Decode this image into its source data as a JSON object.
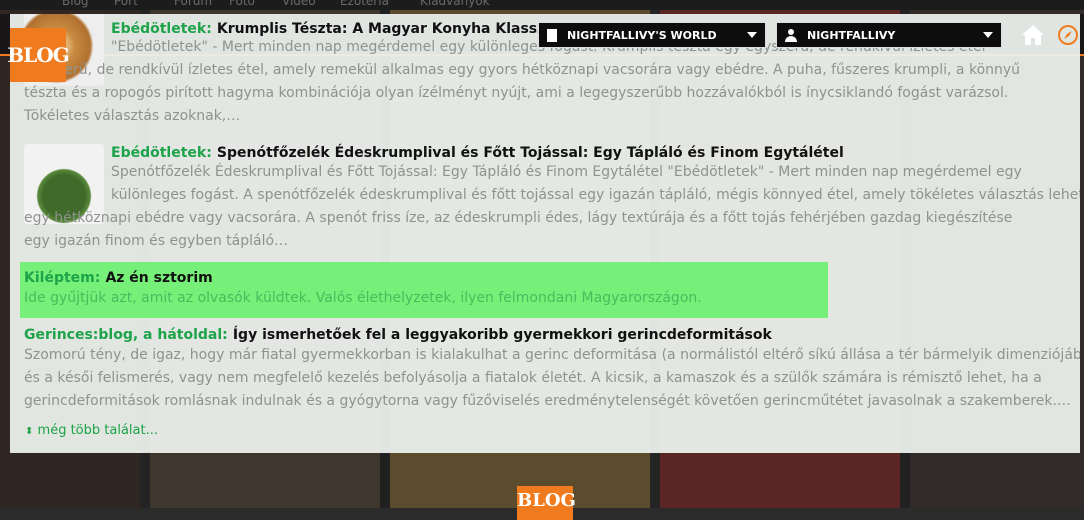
{
  "header": {
    "logo_text": "BLOG",
    "world_dropdown": "NIGHTFALLIVY'S WORLD",
    "user_dropdown": "NIGHTFALLIVY",
    "top_nav": [
      "Blog",
      "Port",
      "Fórum",
      "Fotó",
      "Videó",
      "Ezoteria",
      "Kiadványok"
    ]
  },
  "results": [
    {
      "category": "Ebédötletek:",
      "title": "Krumplis Tészta: A Magyar Konyha Klasszikusa",
      "text_lines": [
        "\"Ebédötletek\" - Mert minden nap megérdemel egy különleges fogást. Krumplis tészta egy egyszerű, de rendkívül ízletes étel",
        "egyszerű, de rendkívül ízletes étel, amely remekül alkalmas egy gyors hétköznapi vacsorára vagy ebédre. A puha, fűszeres krumpli, a könnyű",
        "tészta és a ropogós pirított hagyma kombinációja olyan ízélményt nyújt, ami a legegyszerűbb hozzávalókból is ínycsiklandó fogást varázsol.",
        "Tökéletes választás azoknak,…"
      ]
    },
    {
      "category": "Ebédötletek:",
      "title": "Spenótfőzelék Édeskrumplival és Főtt Tojással: Egy Tápláló és Finom Egytálétel",
      "text_lines": [
        "Spenótfőzelék Édeskrumplival és Főtt Tojással: Egy Tápláló és Finom Egytálétel \"Ebédötletek\" - Mert minden nap megérdemel egy",
        "különleges fogást.   A spenótfőzelék édeskrumplival és főtt tojással egy igazán tápláló, mégis könnyed étel, amely tökéletes választás lehet",
        "egy hétköznapi ebédre vagy vacsorára. A spenót friss íze, az édeskrumpli édes, lágy textúrája és a főtt tojás fehérjében gazdag kiegészítése",
        "egy igazán finom és egyben tápláló…"
      ]
    },
    {
      "category": "Kiléptem:",
      "title": "Az én sztorim",
      "text_lines": [
        "Ide gyűjtjük azt, amit az olvasók küldtek. Valós élethelyzetek, ilyen felmondani Magyarországon."
      ]
    },
    {
      "category": "Gerinces:blog, a hátoldal:",
      "title": "Így ismerhetőek fel a leggyakoribb gyermekkori gerincdeformitások",
      "text_lines": [
        "Szomorú tény, de igaz, hogy már fiatal gyermekkorban is kialakulhat a gerinc deformitása (a normálistól eltérő síkú állása a tér bármelyik dimenziójában)",
        "és a késői felismerés, vagy nem megfelelő kezelés befolyásolja a fiatalok életét. A kicsik, a kamaszok és a szülők számára is rémisztő lehet, ha a",
        "gerincdeformitások romlásnak indulnak és a gyógytorna vagy fűzőviselés eredménytelenségét követően gerincműtétet javasolnak a szakemberek.…"
      ]
    }
  ],
  "more_link": "még több találat..."
}
